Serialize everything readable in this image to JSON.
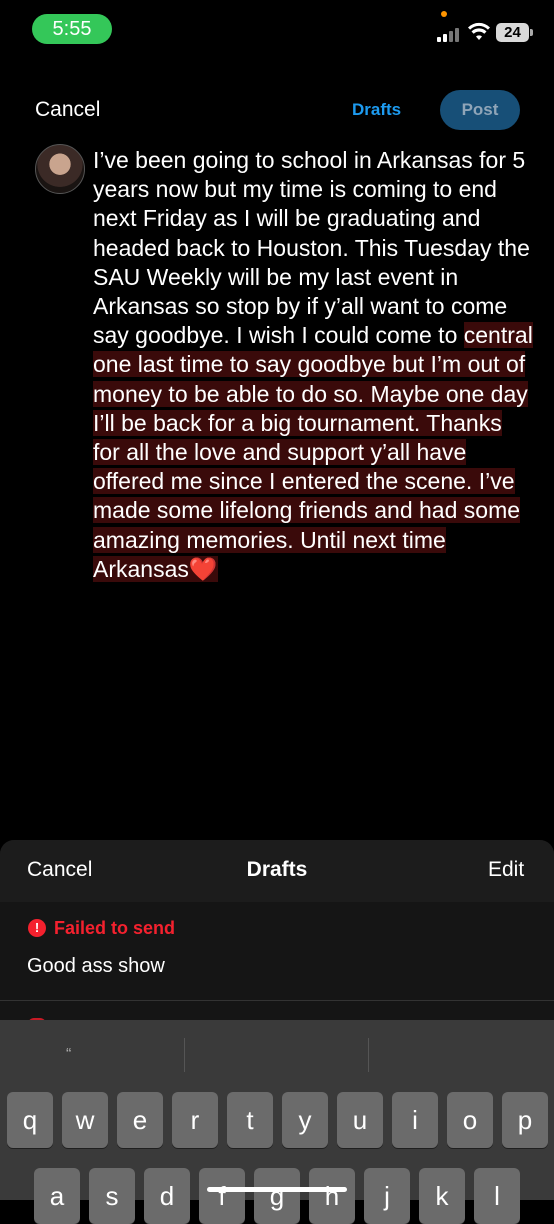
{
  "status_bar": {
    "time": "5:55",
    "battery": "24"
  },
  "compose": {
    "cancel_label": "Cancel",
    "drafts_label": "Drafts",
    "post_label": "Post",
    "text_plain": "I’ve been going to school in Arkansas for 5 years now but my time is coming to end next Friday as I will be graduating and headed back to Houston. This Tuesday the SAU Weekly will be my last event in Arkansas so stop by if y’all want to come say goodbye. I wish I could come to ",
    "text_highlighted": "central one last time to say goodbye but I’m out of money to be able to do so. Maybe one day I’ll be back for a big tournament. Thanks for all the love and support y’all have offered me since I entered the scene. I’ve made some lifelong friends and had some amazing memories. Until next time Arkansas❤️"
  },
  "drafts_panel": {
    "cancel_label": "Cancel",
    "title": "Drafts",
    "edit_label": "Edit",
    "items": [
      {
        "status": "Failed to send",
        "text": "Good ass show"
      }
    ]
  },
  "keyboard": {
    "suggestion": "“",
    "row1": [
      "q",
      "w",
      "e",
      "r",
      "t",
      "y",
      "u",
      "i",
      "o",
      "p"
    ],
    "row2": [
      "a",
      "s",
      "d",
      "f",
      "g",
      "h",
      "j",
      "k",
      "l"
    ]
  },
  "colors": {
    "accent": "#1d9bf0",
    "error": "#f4212e",
    "time_pill": "#34c759"
  }
}
